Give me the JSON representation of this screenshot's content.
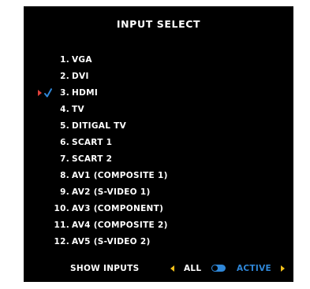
{
  "title": "INPUT SELECT",
  "selected_index": 2,
  "colors": {
    "background": "#000000",
    "text": "#ffffff",
    "selection_arrow": "#e0403a",
    "checkmark": "#2f87d8",
    "footer_arrows": "#f3c11b",
    "active_text": "#2f87d8"
  },
  "inputs": [
    {
      "num": "1.",
      "label": "VGA"
    },
    {
      "num": "2.",
      "label": "DVI"
    },
    {
      "num": "3.",
      "label": "HDMI"
    },
    {
      "num": "4.",
      "label": "TV"
    },
    {
      "num": "5.",
      "label": "DITIGAL TV"
    },
    {
      "num": "6.",
      "label": "SCART 1"
    },
    {
      "num": "7.",
      "label": "SCART 2"
    },
    {
      "num": "8.",
      "label": "AV1 (COMPOSITE 1)"
    },
    {
      "num": "9.",
      "label": "AV2 (S-VIDEO 1)"
    },
    {
      "num": "10.",
      "label": "AV3 (COMPONENT)"
    },
    {
      "num": "11.",
      "label": "AV4 (COMPOSITE 2)"
    },
    {
      "num": "12.",
      "label": "AV5 (S-VIDEO 2)"
    }
  ],
  "footer": {
    "show_inputs_label": "SHOW INPUTS",
    "all_label": "ALL",
    "active_label": "ACTIVE",
    "toggle_state": "ACTIVE"
  },
  "icons": {
    "selection_marker": "red-right-triangle",
    "check": "blue-checkmark",
    "left_arrow": "yellow-left-triangle",
    "right_arrow": "yellow-right-triangle",
    "toggle": "blue-toggle-switch"
  }
}
